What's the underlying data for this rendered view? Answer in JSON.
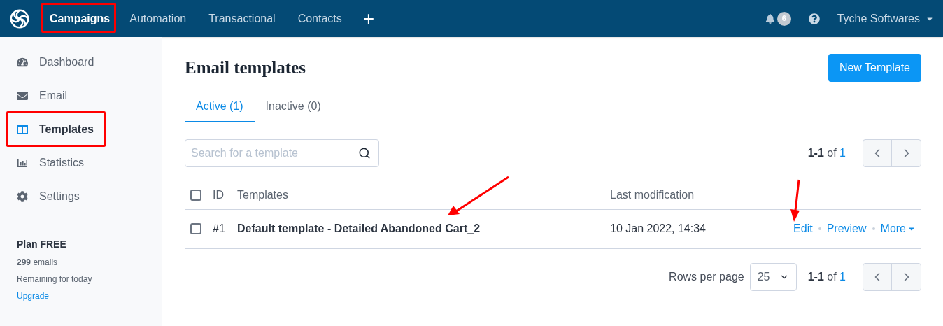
{
  "top_nav": {
    "items": [
      {
        "label": "Campaigns",
        "selected": true
      },
      {
        "label": "Automation",
        "selected": false
      },
      {
        "label": "Transactional",
        "selected": false
      },
      {
        "label": "Contacts",
        "selected": false
      }
    ],
    "add": "+",
    "notifications": "6",
    "account": "Tyche Softwares"
  },
  "sidebar": {
    "items": [
      {
        "label": "Dashboard",
        "selected": false
      },
      {
        "label": "Email",
        "selected": false
      },
      {
        "label": "Templates",
        "selected": true
      },
      {
        "label": "Statistics",
        "selected": false
      },
      {
        "label": "Settings",
        "selected": false
      }
    ],
    "plan": "Plan FREE",
    "emails_count": "299",
    "emails_label": "emails",
    "remaining": "Remaining for today",
    "upgrade": "Upgrade"
  },
  "page": {
    "title": "Email templates",
    "new_button": "New Template",
    "tabs": [
      {
        "label": "Active (1)",
        "selected": true
      },
      {
        "label": "Inactive (0)",
        "selected": false
      }
    ],
    "search": {
      "placeholder": "Search for a template"
    },
    "pagination": {
      "range": "1-1",
      "of": "of",
      "total": "1"
    },
    "table": {
      "select_all_checked": false,
      "columns": [
        "ID",
        "Templates",
        "Last modification"
      ],
      "rows": [
        {
          "checked": false,
          "id": "#1",
          "name": "Default template - Detailed Abandoned Cart_2",
          "modified": "10 Jan 2022, 14:34",
          "actions": [
            "Edit",
            "Preview",
            "More"
          ]
        }
      ]
    },
    "rows_per_page": {
      "label": "Rows per page",
      "value": "25"
    },
    "bottom_pagination": {
      "range": "1-1",
      "of": "of",
      "total": "1"
    }
  }
}
